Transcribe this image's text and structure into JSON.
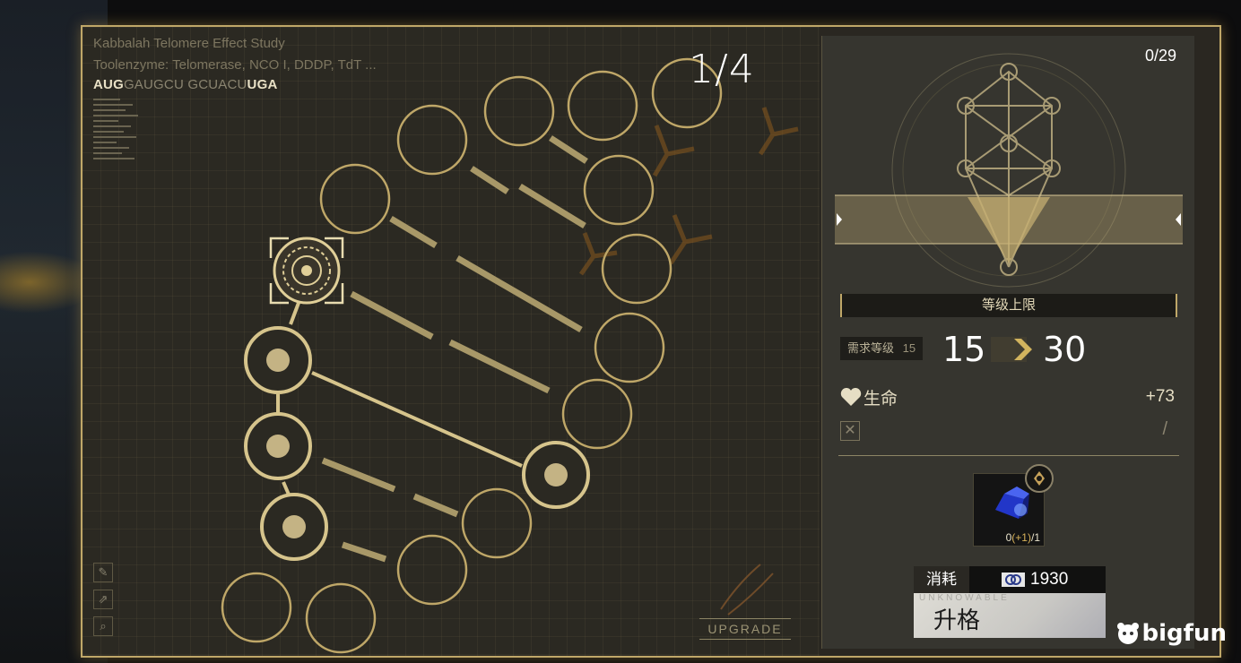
{
  "study": {
    "title": "Kabbalah Telomere Effect Study",
    "subtitle": "Toolenzyme: Telomerase, NCO I, DDDP, TdT ...",
    "codon_start": "AUG",
    "codon_mid": "GAUGCU GCUACU",
    "codon_end": "UGA"
  },
  "page_counter": "1/4",
  "upgrade_tag": "UPGRADE",
  "helix_progress": {
    "filled_nodes": 4
  },
  "right_panel": {
    "progress": "0/29",
    "level_cap_label": "等级上限",
    "required_level_label": "需求等级",
    "required_level_value": "15",
    "level_from": "15",
    "level_to": "30",
    "stat_name": "生命",
    "stat_value": "+73",
    "slash": "/",
    "item_count_current": "0",
    "item_count_bonus": "(+1)",
    "item_count_required": "/1",
    "cost_label": "消耗",
    "cost_value": "1930",
    "button_tiny": "UNKNOWABLE",
    "button_label": "升格"
  },
  "watermark": "bigfun",
  "colors": {
    "accent": "#bfa768",
    "gold_text": "#d8b25a",
    "background": "#2b2922"
  }
}
